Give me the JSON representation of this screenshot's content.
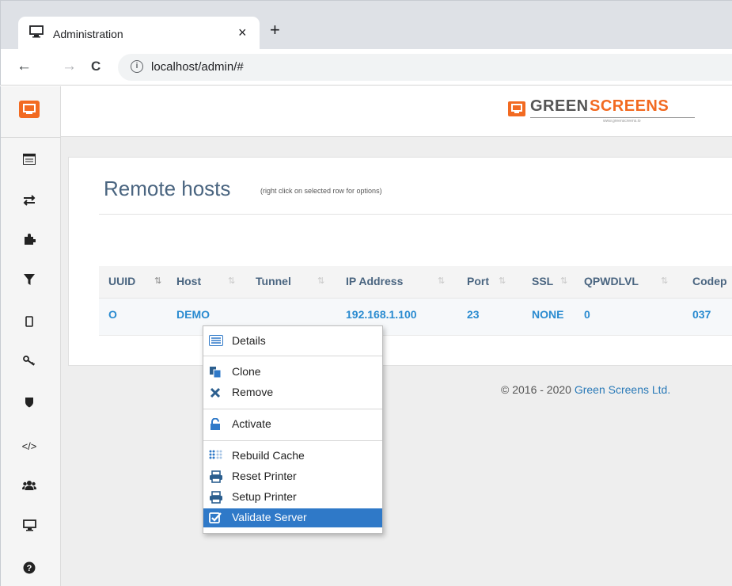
{
  "browser": {
    "tab_title": "Administration",
    "tab_close": "×",
    "new_tab": "+",
    "url": "localhost/admin/#",
    "back": "←",
    "forward": "→",
    "reload": "C",
    "info": "i"
  },
  "brand": {
    "part1": "GREEN",
    "part2": "SCREENS",
    "tagline": "www.greenscreens.io",
    "accent": "#f26a21"
  },
  "sidebar": {
    "items": [
      {
        "name": "table-icon"
      },
      {
        "name": "arrows-exchange-icon"
      },
      {
        "name": "puzzle-icon"
      },
      {
        "name": "filter-icon"
      },
      {
        "name": "mobile-icon"
      },
      {
        "name": "key-icon"
      },
      {
        "name": "shield-icon"
      },
      {
        "name": "code-icon"
      },
      {
        "name": "users-icon"
      },
      {
        "name": "monitor-icon"
      },
      {
        "name": "help-icon"
      }
    ]
  },
  "page": {
    "title": "Remote hosts",
    "hint": "(right click on selected row for options)"
  },
  "table": {
    "columns": [
      "UUID",
      "Host",
      "Tunnel",
      "IP Address",
      "Port",
      "SSL",
      "QPWDLVL",
      "Codep"
    ],
    "rows": [
      {
        "uuid": "O",
        "host": "DEMO",
        "tunnel": "",
        "ip": "192.168.1.100",
        "port": "23",
        "ssl": "NONE",
        "qpwdlvl": "0",
        "codepage": "037"
      }
    ]
  },
  "context_menu": {
    "details": "Details",
    "clone": "Clone",
    "remove": "Remove",
    "activate": "Activate",
    "rebuild_cache": "Rebuild Cache",
    "reset_printer": "Reset Printer",
    "setup_printer": "Setup Printer",
    "validate_server": "Validate Server"
  },
  "footer": {
    "copyright": "© 2016 - 2020",
    "company": "Green Screens Ltd."
  },
  "colors": {
    "link": "#2a8bd0",
    "header_text": "#4a6580",
    "menu_highlight": "#2f79c8"
  }
}
